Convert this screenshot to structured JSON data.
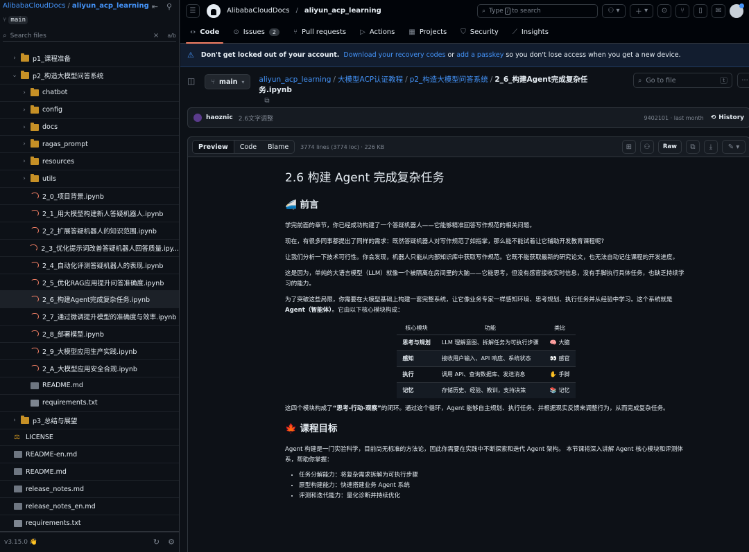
{
  "sidebar": {
    "owner": "AlibabaCloudDocs",
    "repo": "aliyun_acp_learning",
    "branch": "main",
    "search_placeholder": "Search files",
    "search_shortcut": "a/b",
    "items": [
      {
        "label": "p1_课程准备",
        "type": "folder",
        "depth": 1,
        "expanded": false
      },
      {
        "label": "p2_构造大模型问答系统",
        "type": "folder",
        "depth": 1,
        "expanded": true
      },
      {
        "label": "chatbot",
        "type": "folder",
        "depth": 2
      },
      {
        "label": "config",
        "type": "folder",
        "depth": 2
      },
      {
        "label": "docs",
        "type": "folder",
        "depth": 2
      },
      {
        "label": "ragas_prompt",
        "type": "folder",
        "depth": 2
      },
      {
        "label": "resources",
        "type": "folder",
        "depth": 2
      },
      {
        "label": "utils",
        "type": "folder",
        "depth": 2
      },
      {
        "label": "2_0_项目背景.ipynb",
        "type": "notebook",
        "depth": 2
      },
      {
        "label": "2_1_用大模型构建新人答疑机器人.ipynb",
        "type": "notebook",
        "depth": 2
      },
      {
        "label": "2_2_扩展答疑机器人的知识范围.ipynb",
        "type": "notebook",
        "depth": 2
      },
      {
        "label": "2_3_优化提示词改善答疑机器人回答质量.ipy...",
        "type": "notebook",
        "depth": 2
      },
      {
        "label": "2_4_自动化评测答疑机器人的表现.ipynb",
        "type": "notebook",
        "depth": 2
      },
      {
        "label": "2_5_优化RAG应用提升问答准确度.ipynb",
        "type": "notebook",
        "depth": 2
      },
      {
        "label": "2_6_构建Agent完成复杂任务.ipynb",
        "type": "notebook",
        "depth": 2,
        "selected": true
      },
      {
        "label": "2_7_通过微调提升模型的准确度与效率.ipynb",
        "type": "notebook",
        "depth": 2
      },
      {
        "label": "2_8_部署模型.ipynb",
        "type": "notebook",
        "depth": 2
      },
      {
        "label": "2_9_大模型应用生产实践.ipynb",
        "type": "notebook",
        "depth": 2
      },
      {
        "label": "2_A_大模型应用安全合规.ipynb",
        "type": "notebook",
        "depth": 2
      },
      {
        "label": "README.md",
        "type": "md",
        "depth": 2
      },
      {
        "label": "requirements.txt",
        "type": "txt",
        "depth": 2
      },
      {
        "label": "p3_总结与展望",
        "type": "folder",
        "depth": 1,
        "expanded": false
      },
      {
        "label": "LICENSE",
        "type": "license",
        "depth": 0
      },
      {
        "label": "README-en.md",
        "type": "md",
        "depth": 0
      },
      {
        "label": "README.md",
        "type": "md",
        "depth": 0
      },
      {
        "label": "release_notes.md",
        "type": "md",
        "depth": 0
      },
      {
        "label": "release_notes_en.md",
        "type": "md",
        "depth": 0
      },
      {
        "label": "requirements.txt",
        "type": "txt",
        "depth": 0
      }
    ],
    "version": "v3.15.0"
  },
  "topbar": {
    "owner": "AlibabaCloudDocs",
    "repo": "aliyun_acp_learning",
    "search_pre": "Type",
    "search_key": "/",
    "search_post": "to search"
  },
  "tabs": [
    {
      "label": "Code",
      "icon": "code-icon",
      "active": true
    },
    {
      "label": "Issues",
      "icon": "issue-icon",
      "count": "2"
    },
    {
      "label": "Pull requests",
      "icon": "pr-icon"
    },
    {
      "label": "Actions",
      "icon": "play-icon"
    },
    {
      "label": "Projects",
      "icon": "table-icon"
    },
    {
      "label": "Security",
      "icon": "shield-icon"
    },
    {
      "label": "Insights",
      "icon": "graph-icon"
    }
  ],
  "banner": {
    "bold": "Don't get locked out of your account.",
    "link1": "Download your recovery codes",
    "or": "or",
    "link2": "add a passkey",
    "tail": "so you don't lose access when you get a new device."
  },
  "path": {
    "branch": "main",
    "crumbs": [
      "aliyun_acp_learning",
      "大模型ACP认证教程",
      "p2_构造大模型问答系统"
    ],
    "file": "2_6_构建Agent完成复杂任务.ipynb",
    "goto_placeholder": "Go to file",
    "goto_key": "t"
  },
  "commit": {
    "user": "haoznic",
    "message": "2.6文字调整",
    "meta": "9402101 · last month",
    "history": "History"
  },
  "filehead": {
    "tabs": [
      "Preview",
      "Code",
      "Blame"
    ],
    "meta": "3774 lines (3774 loc) · 226 KB",
    "raw": "Raw"
  },
  "doc": {
    "title": "2.6 构建 Agent 完成复杂任务",
    "h_intro": "🚄 前言",
    "p1": "学完前面的章节，你已经成功构建了一个答疑机器人——它能够精准回答写作规范的相关问题。",
    "p2": "现在，有很多同事都提出了同样的需求：既然答疑机器人对写作规范了如指掌，那么能不能试着让它辅助开发教育课程呢?",
    "p3": "让我们分析一下技术可行性。你会发现，机器人只能从内部知识库中获取写作规范。它既不能获取最新的研究论文，也无法自动记住课程的开发进度。",
    "p4": "这是因为，单纯的大语言模型（LLM）就像一个被隔离在房间里的大脑——它能思考，但没有感官接收实时信息，没有手脚执行具体任务，也缺乏持续学习的能力。",
    "p5a": "为了突破这些局限，你需要在大模型基础上构建一套完整系统，让它像业务专家一样感知环境、思考规划、执行任务并从经验中学习。这个系统就是",
    "p5b": "Agent（智能体）",
    "p5c": "。它由以下核心模块构成：",
    "table_head": [
      "核心模块",
      "功能",
      "类比"
    ],
    "table_rows": [
      [
        "思考与规划",
        "LLM 理解意图、拆解任务为可执行步骤",
        "🧠 大脑"
      ],
      [
        "感知",
        "接收用户输入、API 响应、系统状态",
        "👀 感官"
      ],
      [
        "执行",
        "调用 API、查询数据库、发送消息",
        "✋ 手脚"
      ],
      [
        "记忆",
        "存储历史、经验、教训，支持决策",
        "📚 记忆"
      ]
    ],
    "p6a": "这四个模块构成了",
    "p6b": "“思考-行动-观察”",
    "p6c": "的闭环。通过这个循环，Agent 能够自主规划、执行任务、并根据现实反馈来调整行为，从而完成复杂任务。",
    "h_goal": "🍁 课程目标",
    "p7": "Agent 构建是一门实验科学，目前尚无标准的方法论，因此你需要在实践中不断探索和迭代 Agent 架构。 本节课将深入讲解 Agent 核心模块和评测体系，帮助你掌握：",
    "bullets": [
      "任务分解能力：将复杂需求拆解为可执行步骤",
      "原型构建能力：快速搭建业务 Agent 系统",
      "评测和迭代能力：量化诊断并持续优化"
    ]
  }
}
